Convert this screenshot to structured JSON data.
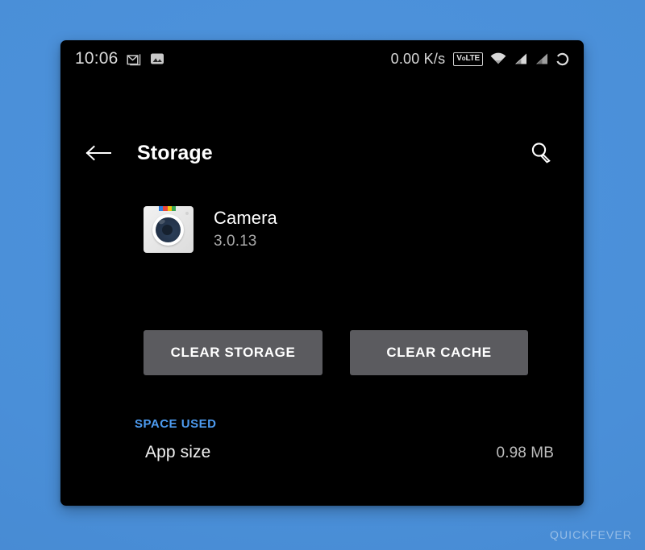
{
  "theme": {
    "backdrop_color": "#4a90d9",
    "panel_background": "#000000",
    "accent_color": "#4d9bf0",
    "button_color": "#5b5b5f",
    "primary_text": "#ffffff",
    "secondary_text": "#a9a9a9"
  },
  "status_bar": {
    "clock": "10:06",
    "notification_icons": [
      "gmail-icon",
      "gallery-icon"
    ],
    "network_speed": "0.00 K/s",
    "volte_label_prefix": "V",
    "volte_label_small": "o",
    "volte_label_suffix": "LTE",
    "volte_label": "VoLTE",
    "right_icons": [
      "wifi-icon",
      "signal-bar-icon",
      "signal-bar-secondary-icon",
      "battery-ring-icon"
    ]
  },
  "app_bar": {
    "back_icon": "arrow-left-icon",
    "title": "Storage",
    "search_icon": "search-icon"
  },
  "app_info": {
    "icon": "camera-app-icon",
    "icon_stripe_colors": [
      "#2f7fe0",
      "#e8453c",
      "#f4c20d",
      "#3aa757"
    ],
    "name": "Camera",
    "version": "3.0.13"
  },
  "actions": {
    "clear_storage_label": "CLEAR STORAGE",
    "clear_cache_label": "CLEAR CACHE"
  },
  "space_used": {
    "section_header": "SPACE USED",
    "rows": [
      {
        "label": "App size",
        "value": "0.98 MB"
      }
    ]
  },
  "watermark": {
    "text": "QUICKFEVER"
  }
}
